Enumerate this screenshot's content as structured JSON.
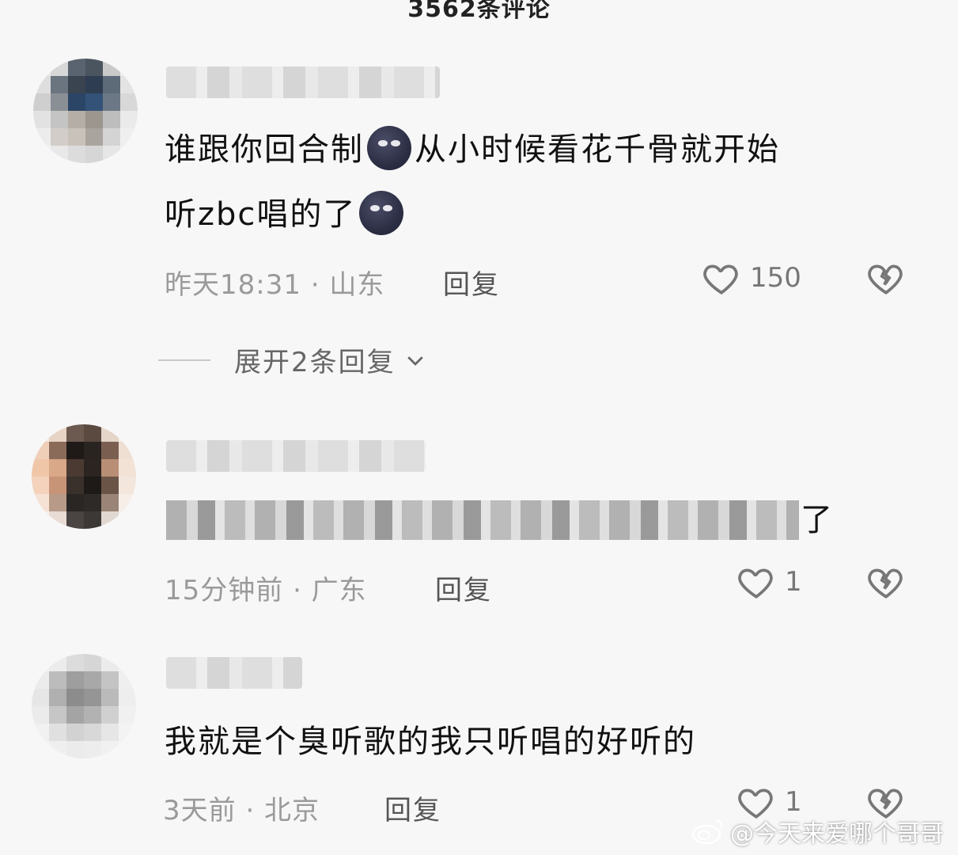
{
  "header": {
    "title": "3562条评论"
  },
  "comments": [
    {
      "text_before_emoji": "谁跟你回合制",
      "text_mid": "从小时候看花千骨就开始",
      "text_line2": "听zbc唱的了",
      "meta": "昨天18:31 · 山东",
      "reply_label": "回复",
      "likes": "150"
    },
    {
      "text_visible_tail": "了",
      "meta": "15分钟前 · 广东",
      "reply_label": "回复",
      "likes": "1"
    },
    {
      "text": "我就是个臭听歌的我只听唱的好听的",
      "meta": "3天前 · 北京",
      "reply_label": "回复",
      "likes": "1"
    }
  ],
  "expand_replies": {
    "label": "展开2条回复"
  },
  "watermark": {
    "text": "@今天来爱哪个哥哥"
  },
  "colors": {
    "background": "#f7f7f7",
    "meta": "#9a9a9a",
    "icon": "#777777"
  }
}
